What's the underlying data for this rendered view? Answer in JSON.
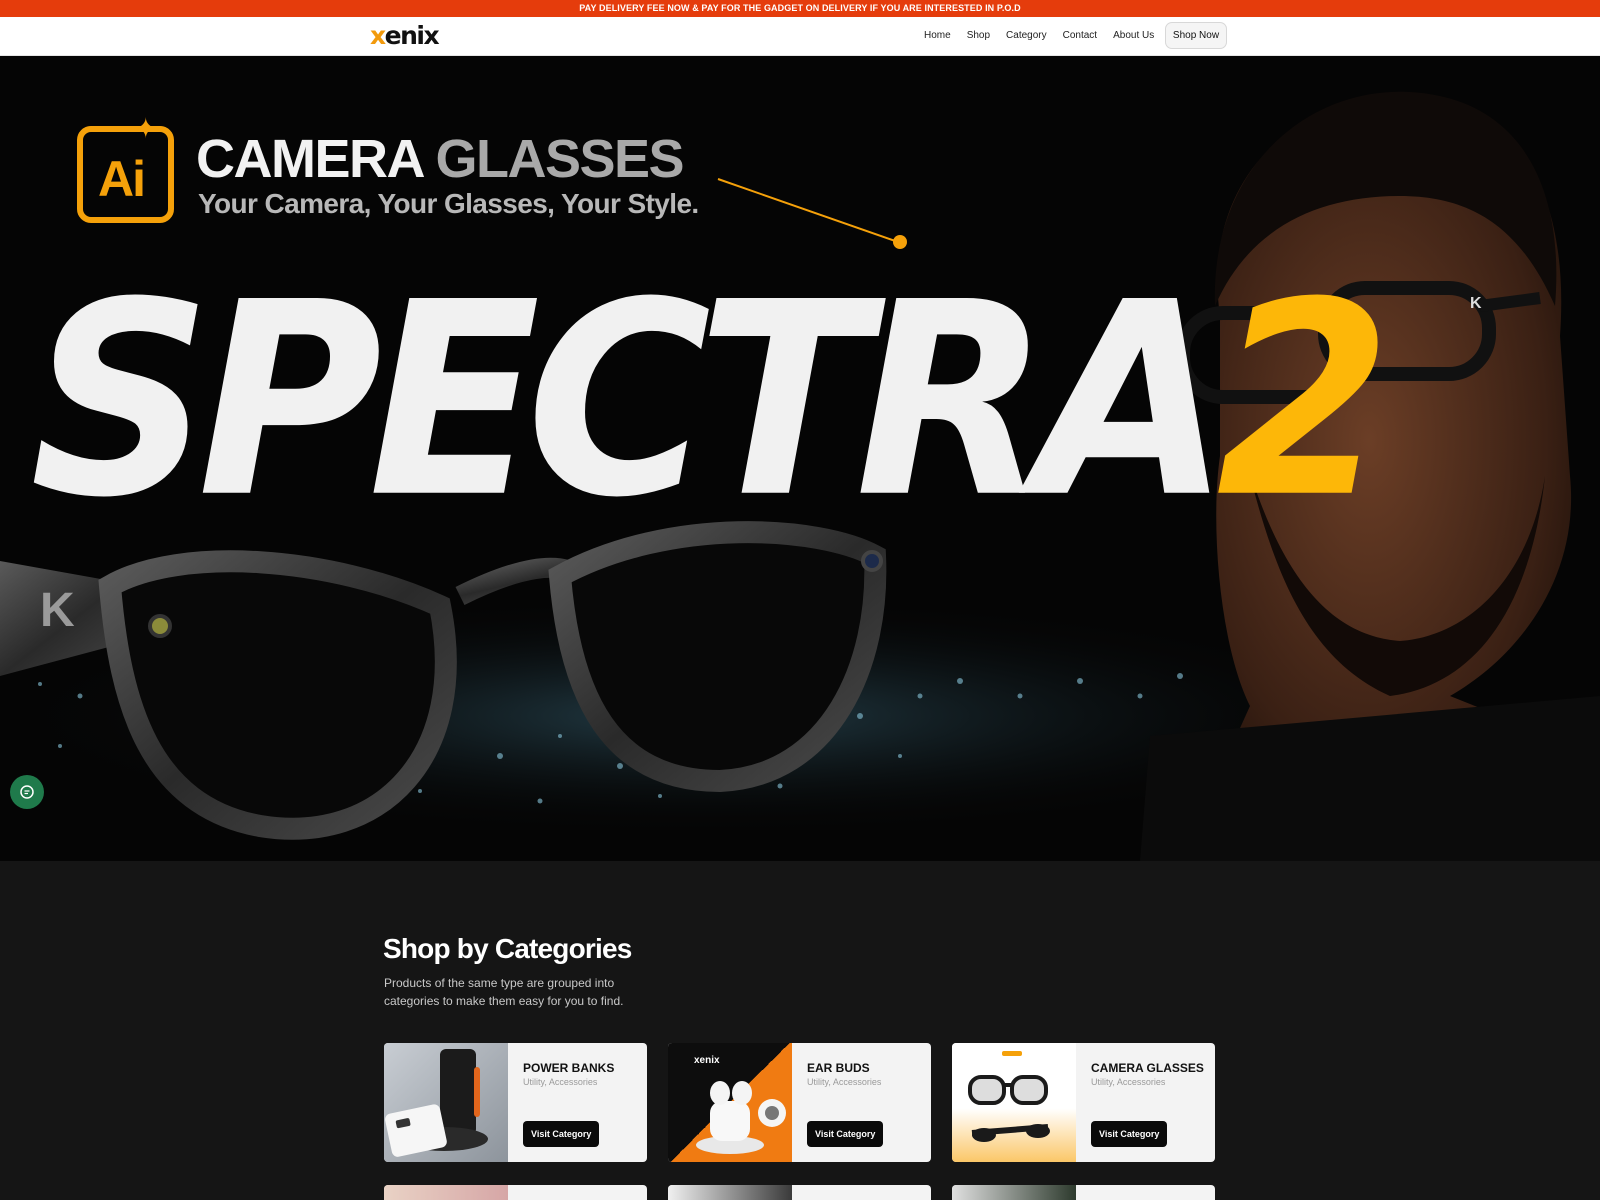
{
  "announcement": "PAY DELIVERY FEE NOW & PAY FOR THE GADGET ON DELIVERY IF YOU ARE INTERESTED IN P.O.D",
  "brand": {
    "logo_prefix": "x",
    "logo_rest": "enix",
    "accent": "#f29a0c"
  },
  "nav": {
    "links": [
      "Home",
      "Shop",
      "Category",
      "Contact",
      "About Us"
    ],
    "cta": "Shop Now"
  },
  "hero": {
    "badge_text": "Ai",
    "title_part1": "CAMERA",
    "title_part2": "GLASSES",
    "tagline": "Your Camera, Your Glasses, Your Style.",
    "product_name": "SPECTRA",
    "product_number": "2",
    "colors": {
      "orange": "#f5a10a",
      "yellow": "#fdb708"
    }
  },
  "chat_icon": "chat-bubble-icon",
  "categories_section": {
    "title": "Shop by Categories",
    "description": "Products of the same type are grouped into categories to make them easy for you to find.",
    "cards": [
      {
        "title": "POWER BANKS",
        "subtitle": "Utility, Accessories",
        "button": "Visit Category"
      },
      {
        "title": "EAR BUDS",
        "subtitle": "Utility, Accessories",
        "button": "Visit Category"
      },
      {
        "title": "CAMERA GLASSES",
        "subtitle": "Utility, Accessories",
        "button": "Visit Category"
      }
    ]
  }
}
